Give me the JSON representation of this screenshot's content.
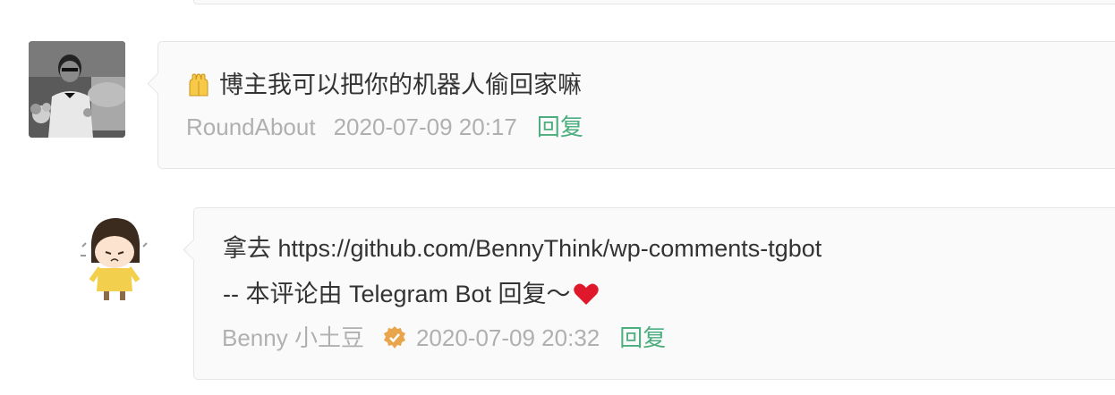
{
  "comments": [
    {
      "text": "博主我可以把你的机器人偷回家嘛",
      "emoji": "pray-hands-icon",
      "author": "RoundAbout",
      "datetime": "2020-07-09 20:17",
      "reply_label": "回复"
    },
    {
      "line1": "拿去 https://github.com/BennyThink/wp-comments-tgbot",
      "line2": "-- 本评论由 Telegram Bot 回复～",
      "heart": "heart-icon",
      "author": "Benny 小土豆",
      "badge": "verified-badge-icon",
      "datetime": "2020-07-09 20:32",
      "reply_label": "回复"
    }
  ],
  "colors": {
    "reply": "#4cae7e",
    "meta": "#b0b0b0",
    "text": "#333333",
    "badge": "#e8a54b",
    "heart": "#e0182c"
  }
}
